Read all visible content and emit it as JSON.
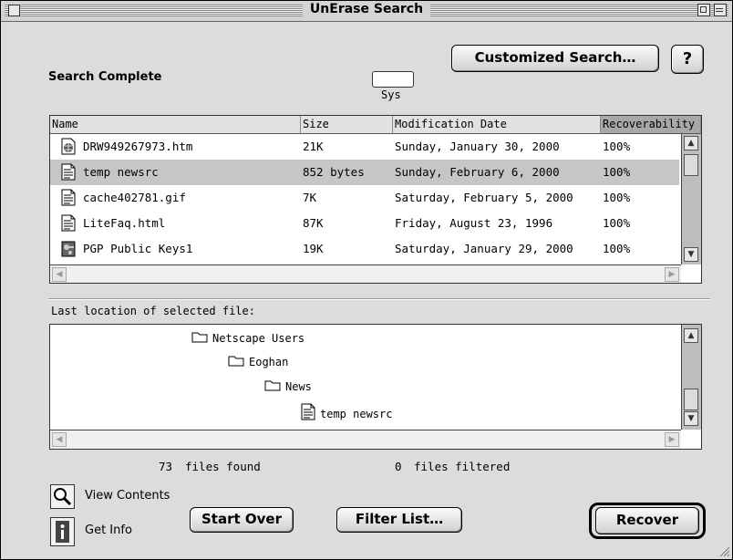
{
  "window": {
    "title": "UnErase Search"
  },
  "header": {
    "status": "Search Complete",
    "customized_search_label": "Customized Search…",
    "help_label": "?",
    "volume_name": "Sys"
  },
  "file_list": {
    "columns": [
      "Name",
      "Size",
      "Modification Date",
      "Recoverability"
    ],
    "rows": [
      {
        "name": "DRW949267973.htm",
        "size": "21K",
        "date": "Sunday, January 30, 2000",
        "recoverability": "100%",
        "icon": "web-document-icon"
      },
      {
        "name": "temp newsrc",
        "size": "852 bytes",
        "date": "Sunday, February 6, 2000",
        "recoverability": "100%",
        "icon": "text-document-icon"
      },
      {
        "name": "cache402781.gif",
        "size": "7K",
        "date": "Saturday, February 5, 2000",
        "recoverability": "100%",
        "icon": "text-document-icon"
      },
      {
        "name": "LiteFaq.html",
        "size": "87K",
        "date": "Friday, August 23, 1996",
        "recoverability": "100%",
        "icon": "text-document-icon"
      },
      {
        "name": "PGP Public Keys1",
        "size": "19K",
        "date": "Saturday, January 29, 2000",
        "recoverability": "100%",
        "icon": "keyring-icon"
      }
    ],
    "selected_index": 1
  },
  "location": {
    "label": "Last location of selected file:",
    "path": [
      "Netscape Users",
      "Eoghan",
      "News",
      "temp newsrc"
    ]
  },
  "stats": {
    "files_found_count": "73",
    "files_found_label": "files found",
    "files_filtered_count": "0",
    "files_filtered_label": "files filtered"
  },
  "actions": {
    "view_contents": "View Contents",
    "get_info": "Get Info",
    "start_over": "Start Over",
    "filter_list": "Filter List…",
    "recover": "Recover"
  }
}
